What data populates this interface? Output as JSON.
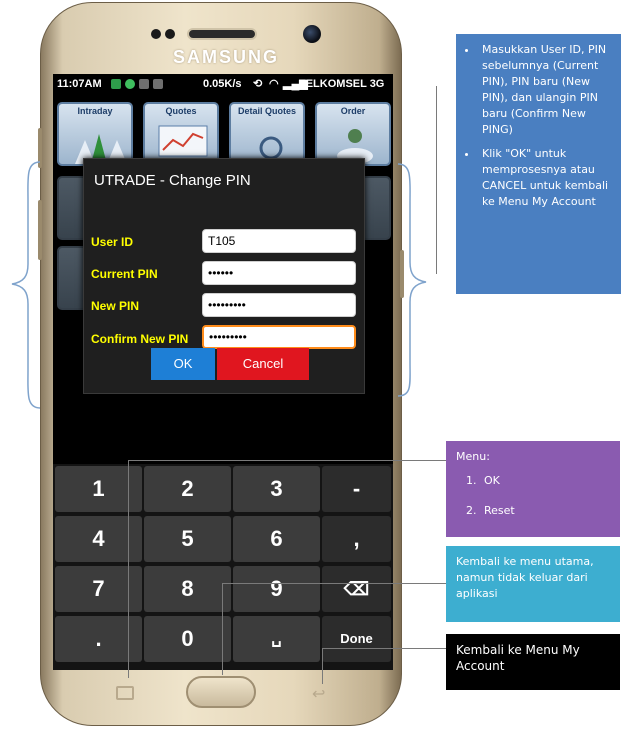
{
  "device": {
    "brand": "SAMSUNG"
  },
  "status_bar": {
    "time": "11:07AM",
    "speed": "0.05K/s",
    "carrier": "TELKOMSEL 3G"
  },
  "tiles": {
    "row1": [
      "Intraday",
      "Quotes",
      "Detail Quotes",
      "Order"
    ]
  },
  "dialog": {
    "title": "UTRADE - Change PIN",
    "fields": [
      {
        "label": "User ID",
        "value": "T105"
      },
      {
        "label": "Current PIN",
        "value": "••••••"
      },
      {
        "label": "New PIN",
        "value": "•••••••••"
      },
      {
        "label": "Confirm New PIN",
        "value": "•••••••••"
      }
    ],
    "ok_label": "OK",
    "cancel_label": "Cancel"
  },
  "keypad": {
    "rows": [
      [
        "1",
        "2",
        "3",
        "-"
      ],
      [
        "4",
        "5",
        "6",
        ","
      ],
      [
        "7",
        "8",
        "9",
        "⌫"
      ],
      [
        ".",
        "0",
        "␣",
        "Done"
      ]
    ]
  },
  "annotations": {
    "blue": [
      "Masukkan User ID, PIN sebelumnya (Current PIN), PIN baru (New PIN), dan ulangin PIN baru (Confirm New PING)",
      "Klik \"OK\" untuk memprosesnya atau CANCEL untuk kembali ke Menu My Account"
    ],
    "purple_title": "Menu:",
    "purple_items": [
      "OK",
      "Reset"
    ],
    "teal": "Kembali ke menu utama, namun tidak keluar dari aplikasi",
    "black": "Kembali ke Menu My Account"
  },
  "colors": {
    "note_blue": "#4a7fc1",
    "note_purple": "#8a5bb0",
    "note_teal": "#3daed0",
    "note_black": "#000000",
    "ok_button": "#1e7fd6",
    "cancel_button": "#e0161f",
    "field_label": "#ffff00",
    "focus_border": "#ff8c1a"
  }
}
